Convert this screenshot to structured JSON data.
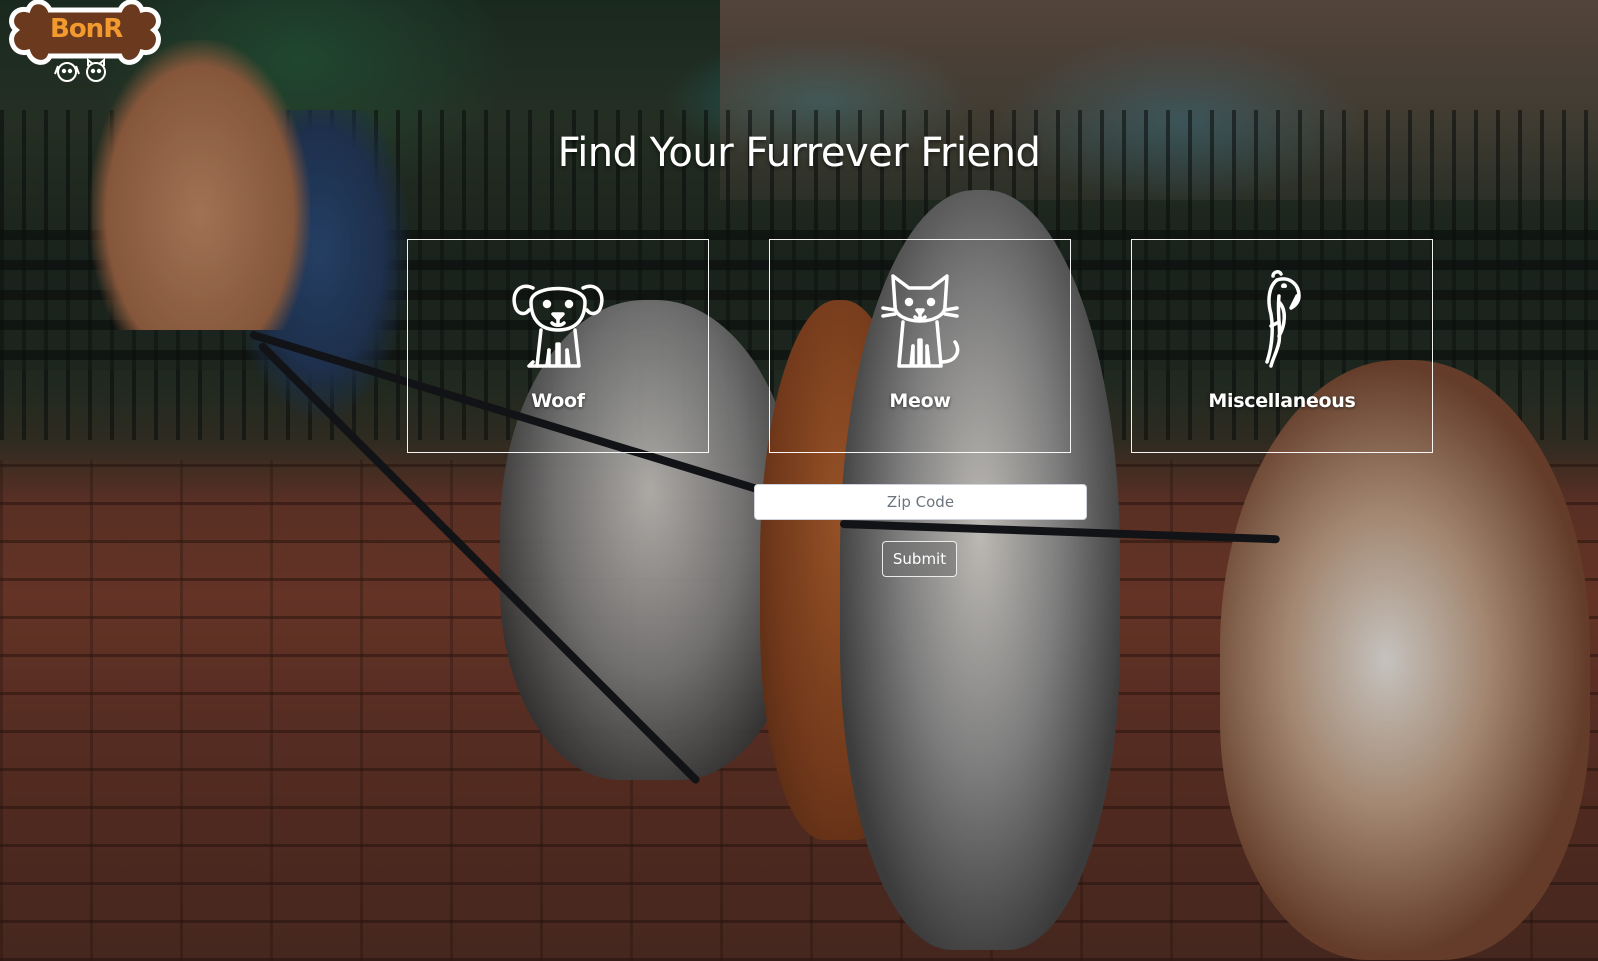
{
  "brand": {
    "logo_text": "BonR"
  },
  "hero": {
    "title": "Find Your Furrever Friend"
  },
  "categories": [
    {
      "label": "Woof",
      "icon": "dog-icon"
    },
    {
      "label": "Meow",
      "icon": "cat-icon"
    },
    {
      "label": "Miscellaneous",
      "icon": "bird-icon"
    }
  ],
  "form": {
    "zip_placeholder": "Zip Code",
    "zip_value": "",
    "submit_label": "Submit"
  },
  "colors": {
    "logo_orange": "#f29a2e",
    "logo_brown": "#6b3a1e",
    "text": "#ffffff"
  }
}
